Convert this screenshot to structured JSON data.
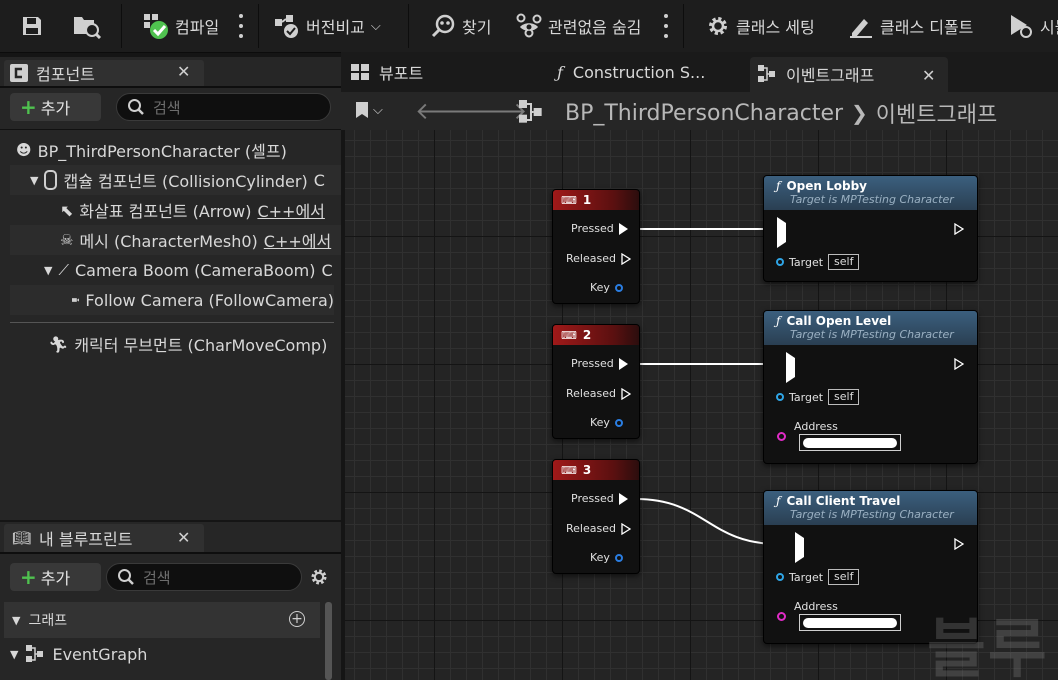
{
  "toolbar": {
    "compile_label": "컴파일",
    "diff_label": "버전비교",
    "find_label": "찾기",
    "hide_unrelated_label": "관련없음 숨김",
    "class_settings_label": "클래스 세팅",
    "class_defaults_label": "클래스 디폴트",
    "simulate_label": "시뮬"
  },
  "components_panel": {
    "tab_label": "컴포넌트",
    "add_label": "추가",
    "search_placeholder": "검색",
    "tree": [
      {
        "label": "BP_ThirdPersonCharacter (셀프)"
      },
      {
        "label": "캡슐 컴포넌트 (CollisionCylinder)",
        "suffix": "C"
      },
      {
        "label": "화살표 컴포넌트 (Arrow)",
        "suffix": "C++에서"
      },
      {
        "label": "메시 (CharacterMesh0)",
        "suffix": "C++에서"
      },
      {
        "label": "Camera Boom (CameraBoom)",
        "suffix": "C"
      },
      {
        "label": "Follow Camera (FollowCamera)"
      },
      {
        "label": "캐릭터 무브먼트 (CharMoveComp)"
      }
    ]
  },
  "blueprint_panel": {
    "tab_label": "내 블루프린트",
    "add_label": "추가",
    "search_placeholder": "검색",
    "graph_section": "그래프",
    "event_graph": "EventGraph"
  },
  "editor_tabs": [
    {
      "label": "뷰포트"
    },
    {
      "label": "Construction S..."
    },
    {
      "label": "이벤트그래프"
    }
  ],
  "breadcrumb": {
    "blueprint": "BP_ThirdPersonCharacter",
    "graph": "이벤트그래프"
  },
  "key_nodes": [
    {
      "title": "1",
      "pressed": "Pressed",
      "released": "Released",
      "key": "Key"
    },
    {
      "title": "2",
      "pressed": "Pressed",
      "released": "Released",
      "key": "Key"
    },
    {
      "title": "3",
      "pressed": "Pressed",
      "released": "Released",
      "key": "Key"
    }
  ],
  "function_nodes": [
    {
      "title": "Open Lobby",
      "subtitle": "Target is MPTesting Character",
      "target_label": "Target",
      "target_value": "self"
    },
    {
      "title": "Call Open Level",
      "subtitle": "Target is MPTesting Character",
      "target_label": "Target",
      "target_value": "self",
      "param_label": "Address"
    },
    {
      "title": "Call Client Travel",
      "subtitle": "Target is MPTesting Character",
      "target_label": "Target",
      "target_value": "self",
      "param_label": "Address"
    }
  ],
  "watermark": "블루",
  "colors": {
    "exec_wire": "#ffffff",
    "key_header": "#a01919",
    "function_header": "#3b5f7e",
    "object_pin": "#2fa5e6",
    "string_pin": "#e02bc6",
    "add_plus": "#4fc24f"
  },
  "icons": [
    "save-icon",
    "browse-icon",
    "compile-status-icon",
    "diff-icon",
    "find-icon",
    "hide-unrelated-icon",
    "gear-icon",
    "class-defaults-icon",
    "simulate-icon"
  ]
}
